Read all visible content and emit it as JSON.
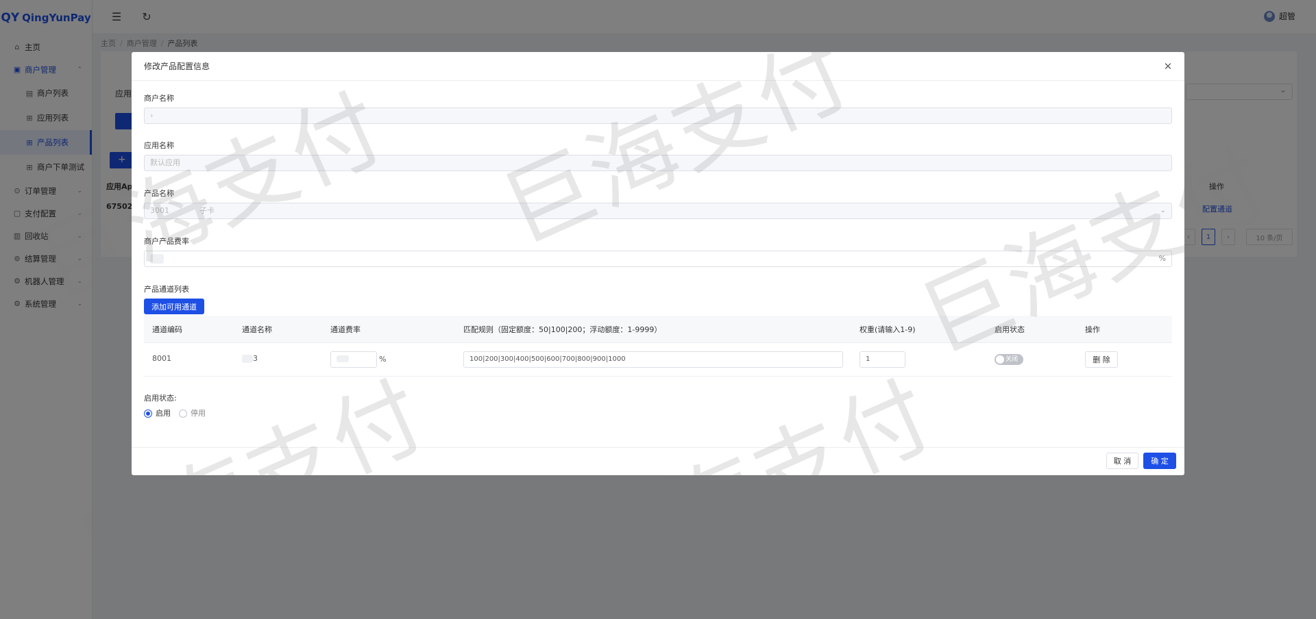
{
  "app": {
    "logo_mark": "QY",
    "logo_name": "QingYunPay"
  },
  "sidebar": {
    "items": [
      {
        "label": "主页",
        "icon": "home-icon"
      },
      {
        "label": "商户管理",
        "icon": "store-icon"
      },
      {
        "label": "商户列表",
        "icon": "list-icon"
      },
      {
        "label": "应用列表",
        "icon": "grid-icon"
      },
      {
        "label": "产品列表",
        "icon": "grid-icon"
      },
      {
        "label": "商户下单测试",
        "icon": "grid-icon"
      },
      {
        "label": "订单管理",
        "icon": "order-icon"
      },
      {
        "label": "支付配置",
        "icon": "pay-icon"
      },
      {
        "label": "回收站",
        "icon": "trash-icon"
      },
      {
        "label": "结算管理",
        "icon": "settle-icon"
      },
      {
        "label": "机器人管理",
        "icon": "robot-icon"
      },
      {
        "label": "系统管理",
        "icon": "gear-icon"
      }
    ]
  },
  "header": {
    "user_name": "超管"
  },
  "breadcrumb": [
    "主页",
    "商户管理",
    "产品列表"
  ],
  "background": {
    "filter_label": "应用",
    "add_label": "+",
    "col_app": "应用Ap",
    "cell_app": "67502e",
    "col_op": "操作",
    "op_link": "配置通道",
    "page_current": "1",
    "page_size": "10 条/页"
  },
  "modal": {
    "title": "修改产品配置信息",
    "merchant_name_label": "商户名称",
    "merchant_name_value": "›",
    "app_name_label": "应用名称",
    "app_name_placeholder": "默认应用",
    "product_name_label": "产品名称",
    "product_name_code": "3001",
    "product_name_value": "子卡",
    "rate_label": "商户产品费率",
    "rate_suffix": "%",
    "channel_list_label": "产品通道列表",
    "add_channel_button": "添加可用通道",
    "channel_table": {
      "headers": [
        "通道编码",
        "通道名称",
        "通道费率",
        "匹配规则（固定额度：50|100|200；浮动额度：1-9999）",
        "权重(请输入1-9)",
        "启用状态",
        "操作"
      ],
      "rows": [
        {
          "code": "8001",
          "name": "3",
          "rate_suffix": "%",
          "rule": "100|200|300|400|500|600|700|800|900|1000",
          "weight": "1",
          "status": "关闭",
          "delete": "删 除"
        }
      ]
    },
    "status_label": "启用状态:",
    "status_options": [
      "启用",
      "停用"
    ],
    "status_selected": "启用",
    "cancel_button": "取 消",
    "confirm_button": "确 定"
  },
  "watermark": "巨海支付",
  "colors": {
    "primary": "#1e50e6"
  }
}
